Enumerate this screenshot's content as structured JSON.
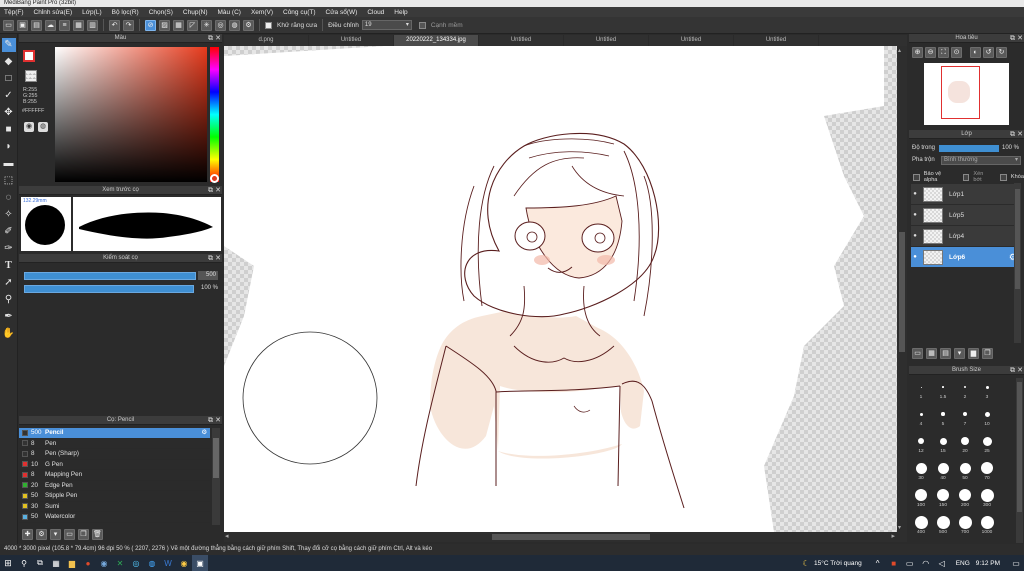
{
  "window": {
    "title": "MediBang Paint Pro (32bit)"
  },
  "menu": [
    "Tệp(F)",
    "Chỉnh sửa(E)",
    "Lớp(L)",
    "Bộ lọc(R)",
    "Chọn(S)",
    "Chụp(N)",
    "Màu (C)",
    "Xem(V)",
    "Công cụ(T)",
    "Cửa sổ(W)",
    "Cloud",
    "Help"
  ],
  "toolbar": {
    "antialias_label": "Khử răng cưa",
    "adjust_label": "Điều chỉnh",
    "adjust_value": "19",
    "snap_label": "Cạnh mềm"
  },
  "color_panel": {
    "title": "Màu",
    "r": "R:255",
    "g": "G:255",
    "b": "B:255",
    "hex": "#FFFFFF",
    "accent": "#e0402a"
  },
  "preview_panel": {
    "title": "Xem trước cọ",
    "size_label": "132.29mm"
  },
  "control_panel": {
    "title": "Kiểm soát cọ",
    "size_value": "500",
    "opacity_value": "100 %"
  },
  "brush_panel": {
    "title": "Cọ: Pencil",
    "brushes": [
      {
        "size": "500",
        "name": "Pencil",
        "color": "#333333",
        "selected": true
      },
      {
        "size": "8",
        "name": "Pen",
        "color": "#333333",
        "selected": false
      },
      {
        "size": "8",
        "name": "Pen (Sharp)",
        "color": "#333333",
        "selected": false
      },
      {
        "size": "10",
        "name": "G Pen",
        "color": "#e03030",
        "selected": false
      },
      {
        "size": "8",
        "name": "Mapping Pen",
        "color": "#e03030",
        "selected": false
      },
      {
        "size": "20",
        "name": "Edge Pen",
        "color": "#30b030",
        "selected": false
      },
      {
        "size": "50",
        "name": "Stipple Pen",
        "color": "#e0c020",
        "selected": false
      },
      {
        "size": "30",
        "name": "Sumi",
        "color": "#e0c020",
        "selected": false
      },
      {
        "size": "50",
        "name": "Watercolor",
        "color": "#5ab0e0",
        "selected": false
      }
    ]
  },
  "tabs": [
    {
      "label": "d.png",
      "active": false
    },
    {
      "label": "Untitled",
      "active": false
    },
    {
      "label": "20220222_134334.jpg",
      "active": true
    },
    {
      "label": "Untitled",
      "active": false
    },
    {
      "label": "Untitled",
      "active": false
    },
    {
      "label": "Untitled",
      "active": false
    },
    {
      "label": "Untitled",
      "active": false
    }
  ],
  "navigator": {
    "title": "Hoa tiêu"
  },
  "layer_panel": {
    "title": "Lớp",
    "opacity_label": "Độ trong",
    "opacity_value": "100 %",
    "blend_label": "Pha trộn",
    "blend_value": "Bình thường",
    "protect_alpha": "Bảo vệ alpha",
    "clipping": "Xén bớt",
    "lock": "Khóa",
    "layers": [
      {
        "name": "Lớp1",
        "selected": false
      },
      {
        "name": "Lớp5",
        "selected": false
      },
      {
        "name": "Lớp4",
        "selected": false
      },
      {
        "name": "Lớp6",
        "selected": true
      }
    ]
  },
  "size_panel": {
    "title": "Brush Size",
    "sizes": [
      "1",
      "1.5",
      "2",
      "3",
      "4",
      "5",
      "7",
      "10",
      "12",
      "15",
      "20",
      "25",
      "30",
      "40",
      "50",
      "70",
      "100",
      "150",
      "200",
      "300",
      "400",
      "500",
      "700",
      "1000"
    ]
  },
  "status": {
    "text": "4000 * 3000 pixel   (105.8 * 79.4cm)   96 dpi   50 %   ( 2207, 2276 )   Vẽ một đường thẳng bằng cách giữ phím Shift, Thay đổi cỡ cọ bằng cách giữ phím Ctrl, Alt và kéo"
  },
  "taskbar": {
    "weather": "15°C  Trời quang",
    "lang": "ENG",
    "time": "9:12 PM"
  }
}
